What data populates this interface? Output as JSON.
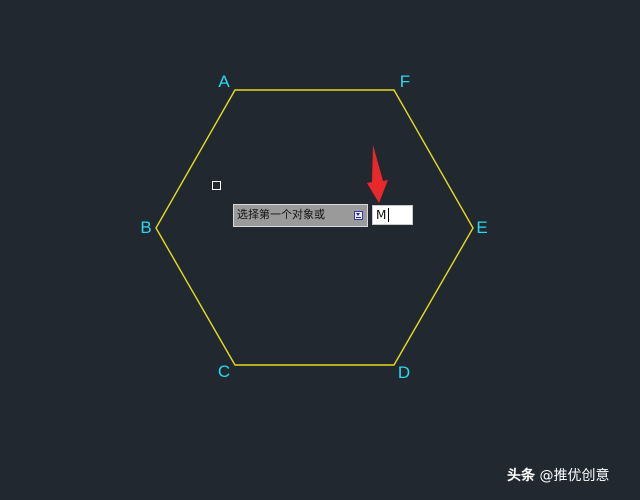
{
  "colors": {
    "background": "#212830",
    "hexagon_stroke": "#e6dc1e",
    "vertex_label": "#28d9ef",
    "annotation_arrow": "#e8282a"
  },
  "drawing": {
    "vertices": [
      {
        "label": "A"
      },
      {
        "label": "F"
      },
      {
        "label": "E"
      },
      {
        "label": "D"
      },
      {
        "label": "C"
      },
      {
        "label": "B"
      }
    ]
  },
  "command_prompt": {
    "prompt_text": "选择第一个对象或",
    "options_icon": "down-arrow-options-icon",
    "input_value": "M"
  },
  "cursor": {
    "icon": "pickbox-cursor-icon"
  },
  "annotation": {
    "icon": "red-arrow-icon"
  },
  "watermark": {
    "brand": "头条",
    "handle": "@推优创意"
  }
}
